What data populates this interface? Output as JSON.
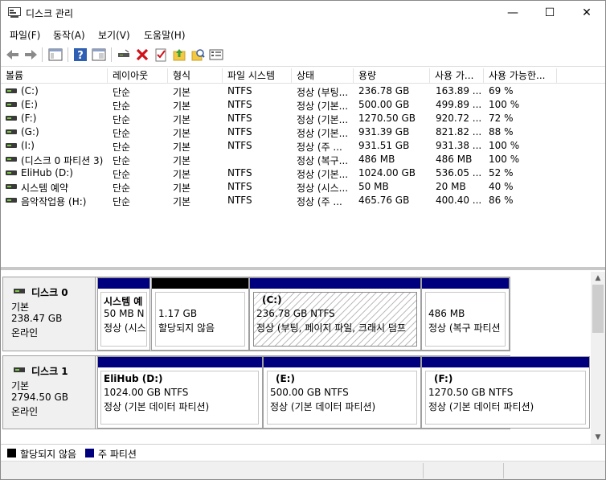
{
  "window": {
    "title": "디스크 관리",
    "minimize": "—",
    "maximize": "☐",
    "close": "✕"
  },
  "menu": [
    "파일(F)",
    "동작(A)",
    "보기(V)",
    "도움말(H)"
  ],
  "toolbar": {
    "icons": [
      "back-arrow-icon",
      "forward-arrow-icon",
      "console-tree-icon",
      "help-icon",
      "properties-icon",
      "connect-icon",
      "delete-icon",
      "checklist-icon",
      "up-folder-icon",
      "search-icon",
      "details-icon"
    ]
  },
  "columns": [
    "볼륨",
    "레이아웃",
    "형식",
    "파일 시스템",
    "상태",
    "용량",
    "사용 가...",
    "사용 가능한..."
  ],
  "volumes": [
    {
      "name": "(C:)",
      "layout": "단순",
      "type": "기본",
      "fs": "NTFS",
      "status": "정상 (부팅...",
      "capacity": "236.78 GB",
      "free": "163.89 ...",
      "pct": "69 %"
    },
    {
      "name": "(E:)",
      "layout": "단순",
      "type": "기본",
      "fs": "NTFS",
      "status": "정상 (기본...",
      "capacity": "500.00 GB",
      "free": "499.89 ...",
      "pct": "100 %"
    },
    {
      "name": "(F:)",
      "layout": "단순",
      "type": "기본",
      "fs": "NTFS",
      "status": "정상 (기본...",
      "capacity": "1270.50 GB",
      "free": "920.72 ...",
      "pct": "72 %"
    },
    {
      "name": "(G:)",
      "layout": "단순",
      "type": "기본",
      "fs": "NTFS",
      "status": "정상 (기본...",
      "capacity": "931.39 GB",
      "free": "821.82 ...",
      "pct": "88 %"
    },
    {
      "name": "(I:)",
      "layout": "단순",
      "type": "기본",
      "fs": "NTFS",
      "status": "정상 (주 ...",
      "capacity": "931.51 GB",
      "free": "931.38 ...",
      "pct": "100 %"
    },
    {
      "name": "(디스크 0 파티션 3)",
      "layout": "단순",
      "type": "기본",
      "fs": "",
      "status": "정상 (복구...",
      "capacity": "486 MB",
      "free": "486 MB",
      "pct": "100 %"
    },
    {
      "name": "EliHub (D:)",
      "layout": "단순",
      "type": "기본",
      "fs": "NTFS",
      "status": "정상 (기본...",
      "capacity": "1024.00 GB",
      "free": "536.05 ...",
      "pct": "52 %"
    },
    {
      "name": "시스템 예약",
      "layout": "단순",
      "type": "기본",
      "fs": "NTFS",
      "status": "정상 (시스...",
      "capacity": "50 MB",
      "free": "20 MB",
      "pct": "40 %"
    },
    {
      "name": "음악작업용 (H:)",
      "layout": "단순",
      "type": "기본",
      "fs": "NTFS",
      "status": "정상 (주 ...",
      "capacity": "465.76 GB",
      "free": "400.40 ...",
      "pct": "86 %"
    }
  ],
  "disks": [
    {
      "name": "디스크 0",
      "kind": "기본",
      "size": "238.47 GB",
      "state": "온라인",
      "partitions": [
        {
          "title": "시스템 예",
          "line1": "50 MB N",
          "line2": "정상 (시스"
        },
        {
          "title": "",
          "line1": "1.17 GB",
          "line2": "할당되지 않음"
        },
        {
          "title": "(C:)",
          "line1": "236.78 GB NTFS",
          "line2": "정상 (부팅, 페이지 파일, 크래시 덤프"
        },
        {
          "title": "",
          "line1": "486 MB",
          "line2": "정상 (복구 파티션"
        }
      ]
    },
    {
      "name": "디스크 1",
      "kind": "기본",
      "size": "2794.50 GB",
      "state": "온라인",
      "partitions": [
        {
          "title": "EliHub  (D:)",
          "line1": "1024.00 GB NTFS",
          "line2": "정상 (기본 데이터 파티션)"
        },
        {
          "title": "(E:)",
          "line1": "500.00 GB NTFS",
          "line2": "정상 (기본 데이터 파티션)"
        },
        {
          "title": "(F:)",
          "line1": "1270.50 GB NTFS",
          "line2": "정상 (기본 데이터 파티션)"
        }
      ]
    }
  ],
  "legend": [
    {
      "label": "할당되지 않음",
      "color": "#000000"
    },
    {
      "label": "주 파티션",
      "color": "#00007f"
    }
  ],
  "colors": {
    "primary": "#00007f",
    "unallocated": "#000000"
  }
}
